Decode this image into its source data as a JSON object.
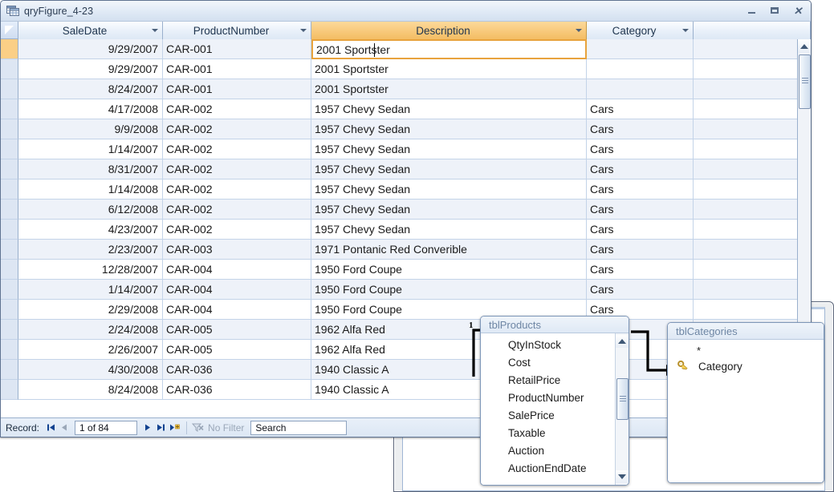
{
  "window": {
    "title": "qryFigure_4-23",
    "icon": "datasheet-icon",
    "minimize_label": "–",
    "restore_label": "▭",
    "close_label": "✕"
  },
  "grid": {
    "columns": [
      {
        "label": "SaleDate",
        "align": "right",
        "selected": false
      },
      {
        "label": "ProductNumber",
        "align": "left",
        "selected": false
      },
      {
        "label": "Description",
        "align": "left",
        "selected": true
      },
      {
        "label": "Category",
        "align": "left",
        "selected": false
      }
    ],
    "rows": [
      {
        "SaleDate": "9/29/2007",
        "ProductNumber": "CAR-001",
        "Description": "2001 Sportster",
        "Category": ""
      },
      {
        "SaleDate": "9/29/2007",
        "ProductNumber": "CAR-001",
        "Description": "2001 Sportster",
        "Category": ""
      },
      {
        "SaleDate": "8/24/2007",
        "ProductNumber": "CAR-001",
        "Description": "2001 Sportster",
        "Category": ""
      },
      {
        "SaleDate": "4/17/2008",
        "ProductNumber": "CAR-002",
        "Description": "1957 Chevy Sedan",
        "Category": "Cars"
      },
      {
        "SaleDate": "9/9/2008",
        "ProductNumber": "CAR-002",
        "Description": "1957 Chevy Sedan",
        "Category": "Cars"
      },
      {
        "SaleDate": "1/14/2007",
        "ProductNumber": "CAR-002",
        "Description": "1957 Chevy Sedan",
        "Category": "Cars"
      },
      {
        "SaleDate": "8/31/2007",
        "ProductNumber": "CAR-002",
        "Description": "1957 Chevy Sedan",
        "Category": "Cars"
      },
      {
        "SaleDate": "1/14/2008",
        "ProductNumber": "CAR-002",
        "Description": "1957 Chevy Sedan",
        "Category": "Cars"
      },
      {
        "SaleDate": "6/12/2008",
        "ProductNumber": "CAR-002",
        "Description": "1957 Chevy Sedan",
        "Category": "Cars"
      },
      {
        "SaleDate": "4/23/2007",
        "ProductNumber": "CAR-002",
        "Description": "1957 Chevy Sedan",
        "Category": "Cars"
      },
      {
        "SaleDate": "2/23/2007",
        "ProductNumber": "CAR-003",
        "Description": "1971 Pontanic Red Converible",
        "Category": "Cars"
      },
      {
        "SaleDate": "12/28/2007",
        "ProductNumber": "CAR-004",
        "Description": "1950 Ford Coupe",
        "Category": "Cars"
      },
      {
        "SaleDate": "1/14/2007",
        "ProductNumber": "CAR-004",
        "Description": "1950 Ford Coupe",
        "Category": "Cars"
      },
      {
        "SaleDate": "2/29/2008",
        "ProductNumber": "CAR-004",
        "Description": "1950 Ford Coupe",
        "Category": "Cars"
      },
      {
        "SaleDate": "2/24/2008",
        "ProductNumber": "CAR-005",
        "Description": "1962 Alfa Red",
        "Category": ""
      },
      {
        "SaleDate": "2/26/2007",
        "ProductNumber": "CAR-005",
        "Description": "1962 Alfa Red",
        "Category": ""
      },
      {
        "SaleDate": "4/30/2008",
        "ProductNumber": "CAR-036",
        "Description": "1940 Classic A",
        "Category": ""
      },
      {
        "SaleDate": "8/24/2008",
        "ProductNumber": "CAR-036",
        "Description": "1940 Classic A",
        "Category": ""
      }
    ]
  },
  "navigator": {
    "record_label": "Record:",
    "first_label": "⏮",
    "prev_label": "◀",
    "position": "1 of 84",
    "next_label": "▶",
    "last_label": "⏭",
    "new_label": "▶✱",
    "filter_label": "No Filter",
    "filter_icon": "funnel-icon",
    "search_value": "Search"
  },
  "field_lists": [
    {
      "name": "tblProducts",
      "title": "tblProducts",
      "fields": [
        "QtyInStock",
        "Cost",
        "RetailPrice",
        "ProductNumber",
        "SalePrice",
        "Taxable",
        "Auction",
        "AuctionEndDate"
      ],
      "has_scrollbar": true
    },
    {
      "name": "tblCategories",
      "title": "tblCategories",
      "star": "*",
      "fields": [
        "Category"
      ],
      "key_field": "Category",
      "key_icon": "primary-key-icon",
      "has_scrollbar": false
    }
  ],
  "relationship": {
    "one_label": "1",
    "arrow_icon": "join-arrow-icon"
  },
  "colors": {
    "selected_header": "#f5c66f",
    "selected_cell_border": "#e8a33d",
    "row_alt": "#eef2f9",
    "grid_line": "#c3d3e8",
    "title_text": "#2b3c52"
  }
}
